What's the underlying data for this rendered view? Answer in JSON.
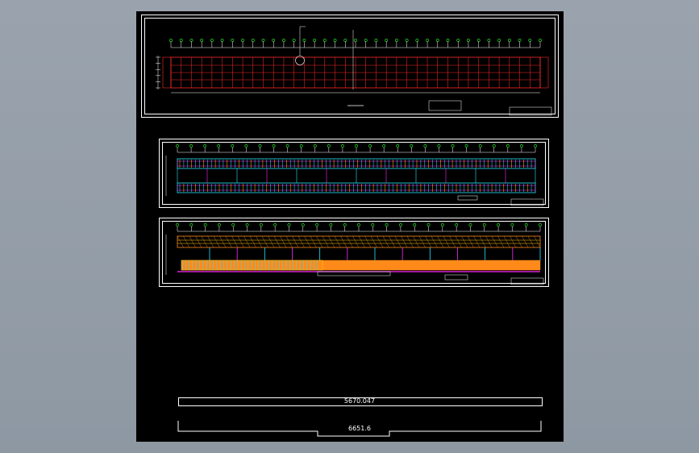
{
  "canvas": {
    "background": "#000000",
    "line_color": "#ffffff",
    "red": "#ff2a2a",
    "yellow": "#ffd200",
    "green": "#2bff2b",
    "cyan": "#27e6ff",
    "magenta": "#ff2aff",
    "orange": "#ff8a1a"
  },
  "dimensions": {
    "upper_value": "5670.047",
    "lower_value": "6651.6"
  }
}
